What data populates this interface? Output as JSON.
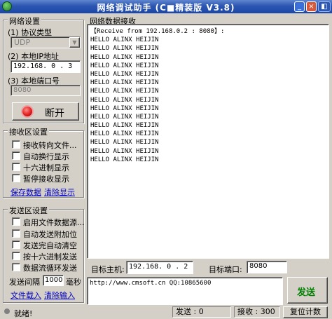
{
  "window": {
    "title": "网络调试助手 (C■精装版 V3.8)",
    "min_btn": "_",
    "close_btn": "×",
    "extra_btn": "◧"
  },
  "net_settings": {
    "group_label": "网络设置",
    "protocol_label": "(1) 协议类型",
    "protocol_value": "UDP",
    "local_ip_label": "(2) 本地IP地址",
    "local_ip_value": "192.168. 0 . 3",
    "local_port_label": "(3) 本地端口号",
    "local_port_value": "8080",
    "connect_button": "断开"
  },
  "recv_settings": {
    "group_label": "接收区设置",
    "options": [
      "接收转向文件...",
      "自动换行显示",
      "十六进制显示",
      "暂停接收显示"
    ],
    "save_link": "保存数据",
    "clear_link": "清除显示"
  },
  "send_settings": {
    "group_label": "发送区设置",
    "options": [
      "启用文件数据源...",
      "自动发送附加位",
      "发送完自动清空",
      "按十六进制发送",
      "数据流循环发送"
    ],
    "interval_label": "发送间隔",
    "interval_value": "1000",
    "interval_unit": "毫秒",
    "file_load_link": "文件载入",
    "clear_input_link": "清除输入"
  },
  "recv_area": {
    "group_label": "网络数据接收",
    "header_line": "【Receive from 192.168.0.2 : 8080】:",
    "lines": [
      "HELLO ALINX HEIJIN",
      "HELLO ALINX HEIJIN",
      "HELLO ALINX HEIJIN",
      "HELLO ALINX HEIJIN",
      "HELLO ALINX HEIJIN",
      "HELLO ALINX HEIJIN",
      "HELLO ALINX HEIJIN",
      "HELLO ALINX HEIJIN",
      "HELLO ALINX HEIJIN",
      "HELLO ALINX HEIJIN",
      "HELLO ALINX HEIJIN",
      "HELLO ALINX HEIJIN",
      "HELLO ALINX HEIJIN",
      "HELLO ALINX HEIJIN",
      "HELLO ALINX HEIJIN"
    ]
  },
  "target": {
    "host_label": "目标主机:",
    "host_value": "192.168. 0 . 2",
    "port_label": "目标端口:",
    "port_value": "8080"
  },
  "send_area": {
    "text": "http://www.cmsoft.cn QQ:10865600",
    "send_button": "发送"
  },
  "status": {
    "ready_text": "就绪!",
    "sent_label": "发送 : 0",
    "recv_label": "接收 : 300",
    "reset_button": "复位计数"
  },
  "colors": {
    "title_bar": "#1c47a6",
    "window_face": "#d4d0c8",
    "link": "#0000c0",
    "send_button_text": "#008000",
    "led": "#e02020"
  }
}
